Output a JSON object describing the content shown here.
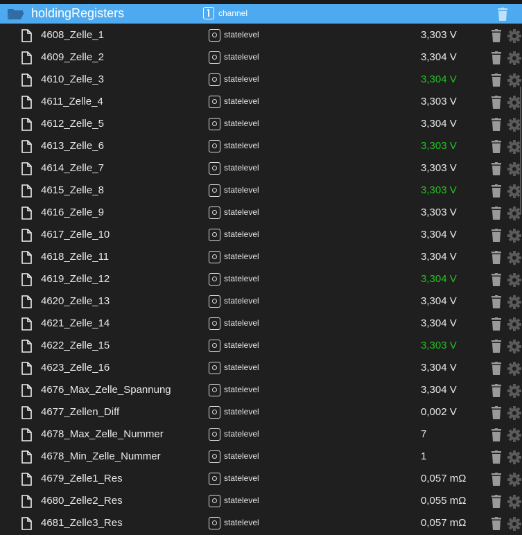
{
  "header": {
    "title": "holdingRegisters",
    "type": "channel"
  },
  "colors": {
    "header_bg": "#4eaaf0",
    "green": "#21c321"
  },
  "rows": [
    {
      "name": "4608_Zelle_1",
      "type": "statelevel",
      "value": "3,303 V",
      "green": false
    },
    {
      "name": "4609_Zelle_2",
      "type": "statelevel",
      "value": "3,304 V",
      "green": false
    },
    {
      "name": "4610_Zelle_3",
      "type": "statelevel",
      "value": "3,304 V",
      "green": true
    },
    {
      "name": "4611_Zelle_4",
      "type": "statelevel",
      "value": "3,303 V",
      "green": false
    },
    {
      "name": "4612_Zelle_5",
      "type": "statelevel",
      "value": "3,304 V",
      "green": false
    },
    {
      "name": "4613_Zelle_6",
      "type": "statelevel",
      "value": "3,303 V",
      "green": true
    },
    {
      "name": "4614_Zelle_7",
      "type": "statelevel",
      "value": "3,303 V",
      "green": false
    },
    {
      "name": "4615_Zelle_8",
      "type": "statelevel",
      "value": "3,303 V",
      "green": true
    },
    {
      "name": "4616_Zelle_9",
      "type": "statelevel",
      "value": "3,303 V",
      "green": false
    },
    {
      "name": "4617_Zelle_10",
      "type": "statelevel",
      "value": "3,304 V",
      "green": false
    },
    {
      "name": "4618_Zelle_11",
      "type": "statelevel",
      "value": "3,304 V",
      "green": false
    },
    {
      "name": "4619_Zelle_12",
      "type": "statelevel",
      "value": "3,304 V",
      "green": true
    },
    {
      "name": "4620_Zelle_13",
      "type": "statelevel",
      "value": "3,304 V",
      "green": false
    },
    {
      "name": "4621_Zelle_14",
      "type": "statelevel",
      "value": "3,304 V",
      "green": false
    },
    {
      "name": "4622_Zelle_15",
      "type": "statelevel",
      "value": "3,303 V",
      "green": true
    },
    {
      "name": "4623_Zelle_16",
      "type": "statelevel",
      "value": "3,304 V",
      "green": false
    },
    {
      "name": "4676_Max_Zelle_Spannung",
      "type": "statelevel",
      "value": "3,304 V",
      "green": false
    },
    {
      "name": "4677_Zellen_Diff",
      "type": "statelevel",
      "value": "0,002 V",
      "green": false
    },
    {
      "name": "4678_Max_Zelle_Nummer",
      "type": "statelevel",
      "value": "7",
      "green": false
    },
    {
      "name": "4678_Min_Zelle_Nummer",
      "type": "statelevel",
      "value": "1",
      "green": false
    },
    {
      "name": "4679_Zelle1_Res",
      "type": "statelevel",
      "value": "0,057 mΩ",
      "green": false
    },
    {
      "name": "4680_Zelle2_Res",
      "type": "statelevel",
      "value": "0,055 mΩ",
      "green": false
    },
    {
      "name": "4681_Zelle3_Res",
      "type": "statelevel",
      "value": "0,057 mΩ",
      "green": false
    }
  ]
}
